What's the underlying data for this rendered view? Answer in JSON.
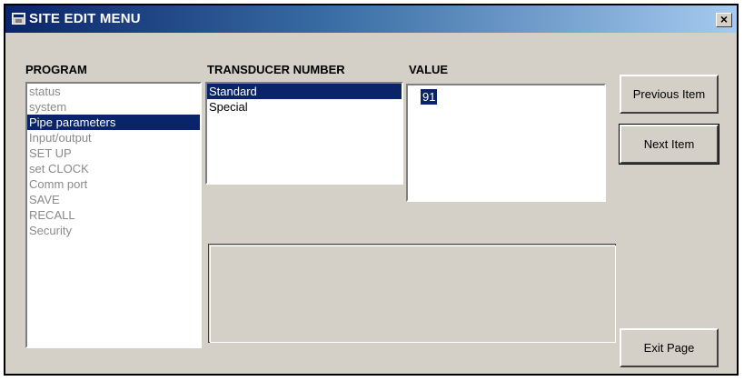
{
  "window": {
    "title": "SITE EDIT MENU",
    "close_label": "×"
  },
  "program": {
    "label": "PROGRAM",
    "items": [
      "status",
      "system",
      "Pipe parameters",
      "Input/output",
      "SET UP",
      "set CLOCK",
      "Comm port",
      "SAVE",
      "RECALL",
      "Security"
    ],
    "selected": "Pipe parameters"
  },
  "transducer": {
    "label": "TRANSDUCER NUMBER",
    "items": [
      "Standard",
      "Special"
    ],
    "selected": "Standard"
  },
  "value": {
    "label": "VALUE",
    "text": "91"
  },
  "buttons": {
    "previous": "Previous Item",
    "next": "Next Item",
    "exit": "Exit Page"
  },
  "colors": {
    "selection": "#0a246a",
    "dialog_bg": "#d4d0c8"
  }
}
